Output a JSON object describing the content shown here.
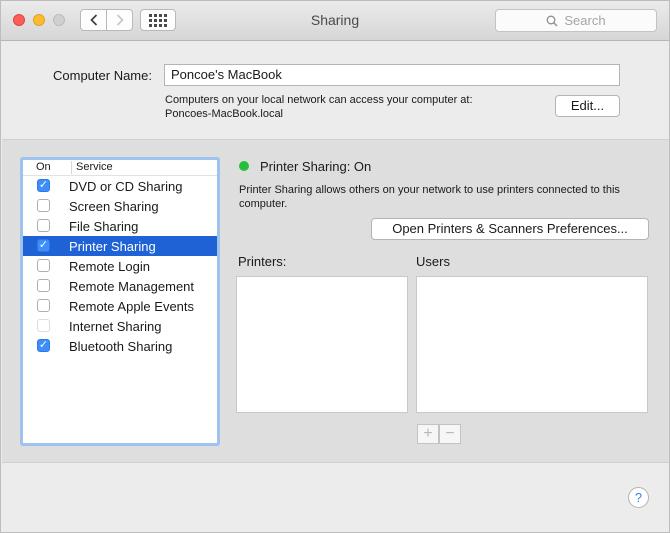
{
  "window": {
    "title": "Sharing"
  },
  "toolbar": {
    "back_icon": "chevron-left-icon",
    "forward_icon": "chevron-right-icon",
    "grid_icon": "grid-icon"
  },
  "search": {
    "placeholder": "Search",
    "icon": "search-icon"
  },
  "computer_name": {
    "label": "Computer Name:",
    "value": "Poncoe's MacBook",
    "info_line1": "Computers on your local network can access your computer at:",
    "info_line2": "Poncoes-MacBook.local",
    "edit_label": "Edit..."
  },
  "services": {
    "header_on": "On",
    "header_service": "Service",
    "items": [
      {
        "label": "DVD or CD Sharing",
        "checked": true,
        "selected": false
      },
      {
        "label": "Screen Sharing",
        "checked": false,
        "selected": false
      },
      {
        "label": "File Sharing",
        "checked": false,
        "selected": false
      },
      {
        "label": "Printer Sharing",
        "checked": true,
        "selected": true
      },
      {
        "label": "Remote Login",
        "checked": false,
        "selected": false
      },
      {
        "label": "Remote Management",
        "checked": false,
        "selected": false
      },
      {
        "label": "Remote Apple Events",
        "checked": false,
        "selected": false
      },
      {
        "label": "Internet Sharing",
        "checked": false,
        "selected": false,
        "dim": true
      },
      {
        "label": "Bluetooth Sharing",
        "checked": true,
        "selected": false
      }
    ]
  },
  "detail": {
    "status_text": "Printer Sharing: On",
    "status_color": "#25c03a",
    "description": "Printer Sharing allows others on your network to use printers connected to this computer.",
    "open_prefs_label": "Open Printers & Scanners Preferences...",
    "printers_label": "Printers:",
    "users_label": "Users",
    "add_symbol": "+",
    "remove_symbol": "−"
  },
  "help": {
    "symbol": "?"
  },
  "colors": {
    "selection": "#1f62d6",
    "checkbox_on": "#3d8ef8",
    "focus_ring": "#9ec3ef"
  }
}
